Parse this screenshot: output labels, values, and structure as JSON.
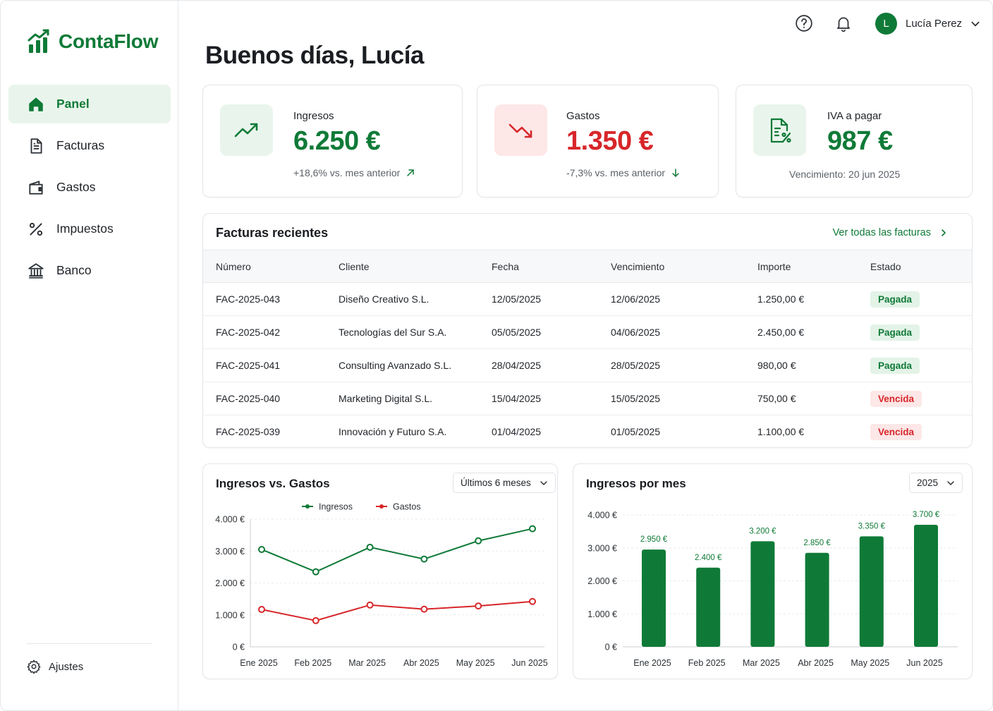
{
  "app": {
    "name": "ContaFlow"
  },
  "sidebar": {
    "items": [
      {
        "label": "Panel",
        "icon": "home-icon",
        "active": true
      },
      {
        "label": "Facturas",
        "icon": "document-icon",
        "active": false
      },
      {
        "label": "Gastos",
        "icon": "wallet-icon",
        "active": false
      },
      {
        "label": "Impuestos",
        "icon": "percent-icon",
        "active": false
      },
      {
        "label": "Banco",
        "icon": "bank-icon",
        "active": false
      }
    ],
    "settings_label": "Ajustes"
  },
  "topbar": {
    "user_initial": "L",
    "user_name": "Lucía Perez"
  },
  "greeting": "Buenos días, Lucía",
  "kpis": {
    "income": {
      "label": "Ingresos",
      "value": "6.250 €",
      "sub": "+18,6% vs. mes anterior",
      "color": "#0f7a37"
    },
    "expenses": {
      "label": "Gastos",
      "value": "1.350 €",
      "sub": "-7,3% vs. mes anterior",
      "color": "#d7262a"
    },
    "vat": {
      "label": "IVA a pagar",
      "value": "987 €",
      "sub": "Vencimiento: 20 jun 2025",
      "color": "#0f7a37"
    }
  },
  "invoices": {
    "title": "Facturas recientes",
    "link": "Ver todas las facturas",
    "columns": [
      "Número",
      "Cliente",
      "Fecha",
      "Vencimiento",
      "Importe",
      "Estado"
    ],
    "rows": [
      [
        "FAC-2025-043",
        "Diseño Creativo S.L.",
        "12/05/2025",
        "12/06/2025",
        "1.250,00 €",
        "Pagada"
      ],
      [
        "FAC-2025-042",
        "Tecnologías del Sur S.A.",
        "05/05/2025",
        "04/06/2025",
        "2.450,00 €",
        "Pagada"
      ],
      [
        "FAC-2025-041",
        "Consulting Avanzado S.L.",
        "28/04/2025",
        "28/05/2025",
        "980,00 €",
        "Pagada"
      ],
      [
        "FAC-2025-040",
        "Marketing Digital S.L.",
        "15/04/2025",
        "15/05/2025",
        "750,00 €",
        "Vencida"
      ],
      [
        "FAC-2025-039",
        "Innovación y Futuro S.A.",
        "01/04/2025",
        "01/05/2025",
        "1.100,00 €",
        "Vencida"
      ]
    ]
  },
  "colors": {
    "brand": "#0f7a37",
    "danger": "#d7262a"
  },
  "chart_data": [
    {
      "type": "line",
      "title": "Ingresos vs. Gastos",
      "filter": "Últimos 6 meses",
      "categories": [
        "Ene 2025",
        "Feb 2025",
        "Mar 2025",
        "Abr 2025",
        "May 2025",
        "Jun 2025"
      ],
      "series": [
        {
          "name": "Ingresos",
          "color": "#0f7a37",
          "values": [
            3050,
            2350,
            3120,
            2750,
            3320,
            3700
          ]
        },
        {
          "name": "Gastos",
          "color": "#d7262a",
          "values": [
            1170,
            820,
            1310,
            1180,
            1280,
            1420
          ]
        }
      ],
      "ylim": [
        0,
        4000
      ],
      "yticks": [
        "0 €",
        "1.000 €",
        "2.000 €",
        "3.000 €",
        "4.000 €"
      ],
      "legend": "top-center",
      "grid": true
    },
    {
      "type": "bar",
      "title": "Ingresos por mes",
      "filter": "2025",
      "categories": [
        "Ene 2025",
        "Feb 2025",
        "Mar 2025",
        "Abr 2025",
        "May 2025",
        "Jun 2025"
      ],
      "values": [
        2950,
        2400,
        3200,
        2850,
        3350,
        3700
      ],
      "labels": [
        "2.950 €",
        "2.400 €",
        "3.200 €",
        "2.850 €",
        "3.350 €",
        "3.700 €"
      ],
      "color": "#0f7a37",
      "ylim": [
        0,
        4000
      ],
      "yticks": [
        "0 €",
        "1.000 €",
        "2.000 €",
        "3.000 €",
        "4.000 €"
      ],
      "grid": true
    }
  ]
}
